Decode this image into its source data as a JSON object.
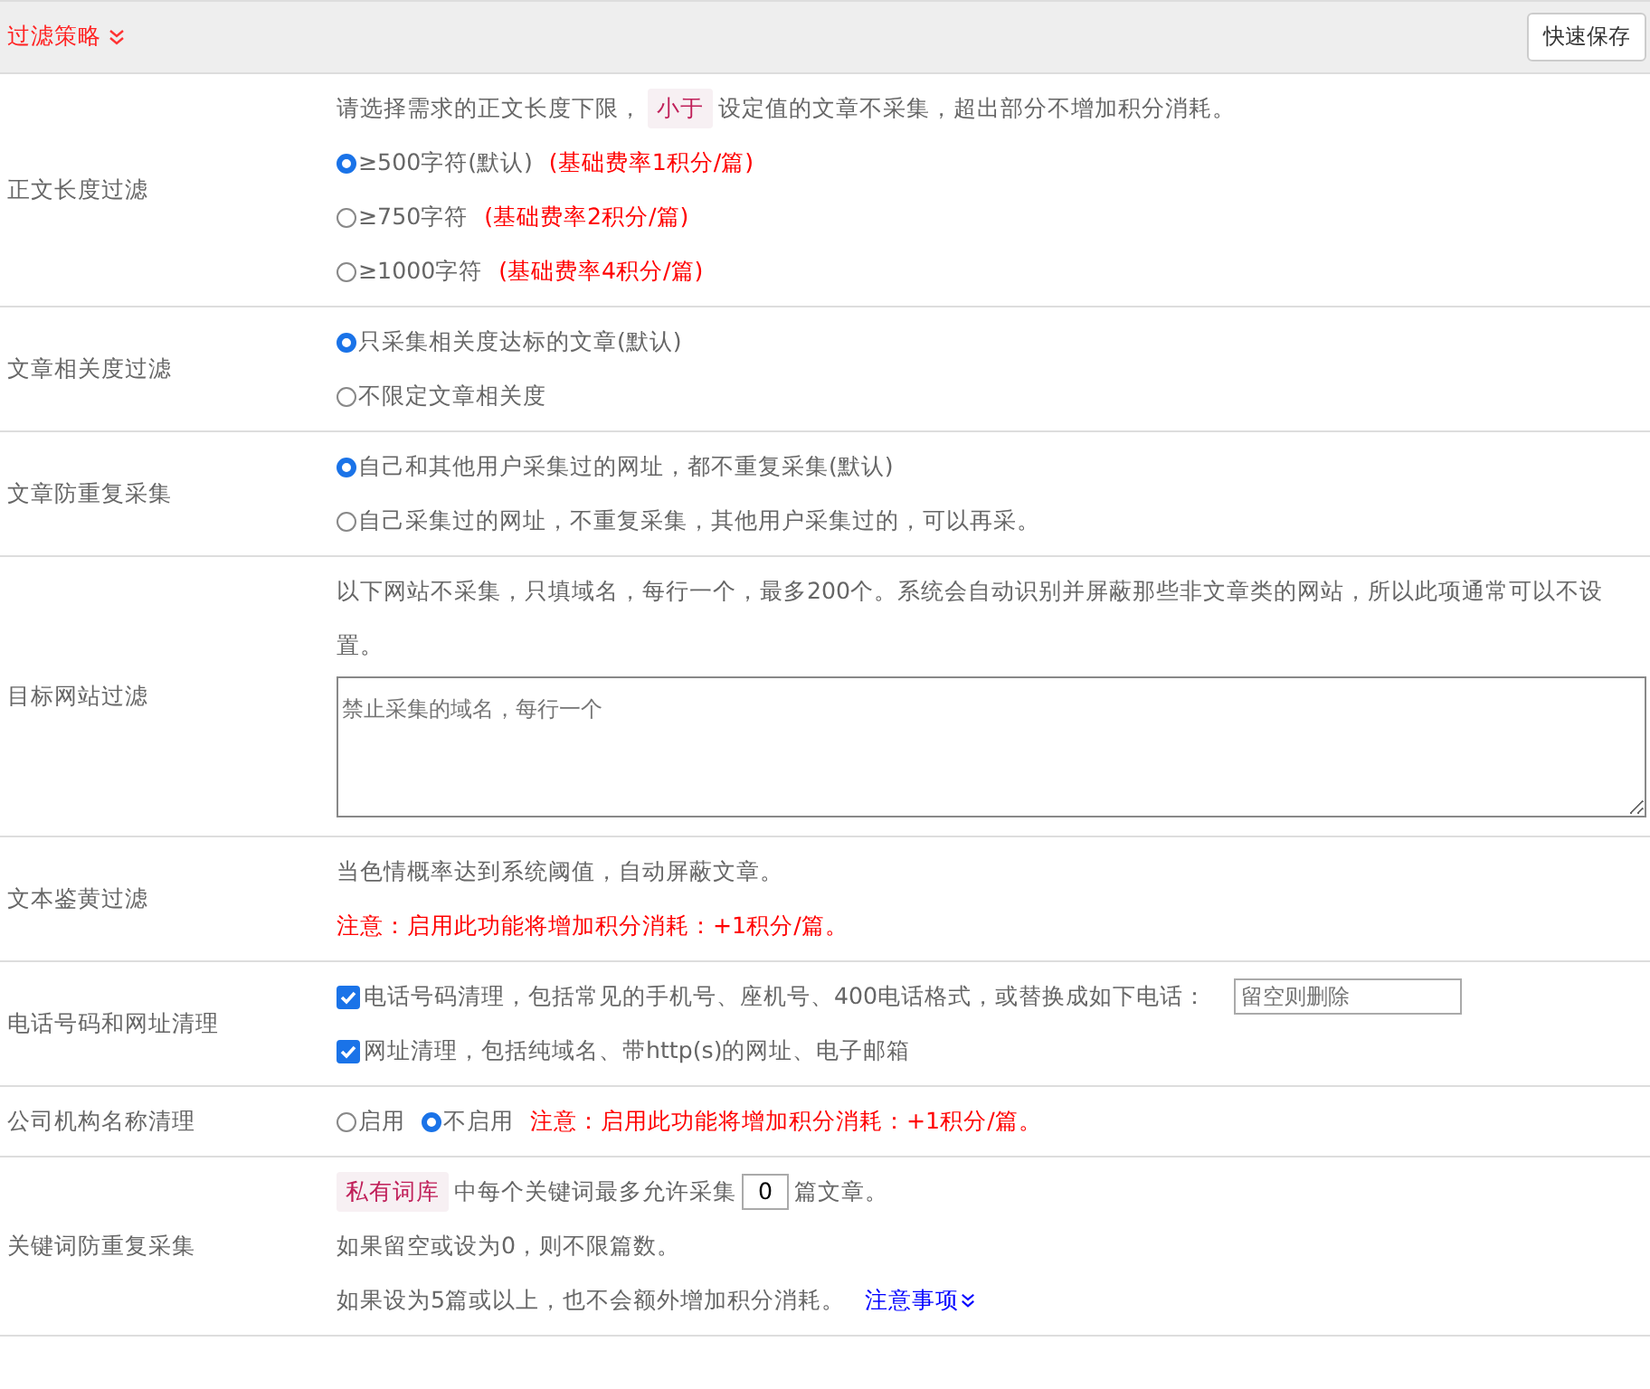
{
  "header": {
    "title": "过滤策略",
    "button": "快速保存"
  },
  "rows": [
    {
      "label": "正文长度过滤",
      "lines": [
        [
          {
            "kind": "text",
            "text": "请选择需求的正文长度下限，"
          },
          {
            "kind": "tag",
            "text": "小于"
          },
          {
            "kind": "text",
            "text": "设定值的文章不采集，超出部分不增加积分消耗。"
          }
        ],
        [
          {
            "kind": "radio",
            "text": "≥500字符(默认)",
            "selected": true
          },
          {
            "kind": "note",
            "text": "(基础费率1积分/篇)"
          }
        ],
        [
          {
            "kind": "radio",
            "text": "≥750字符",
            "selected": false
          },
          {
            "kind": "note",
            "text": "(基础费率2积分/篇)"
          }
        ],
        [
          {
            "kind": "radio",
            "text": "≥1000字符",
            "selected": false
          },
          {
            "kind": "note",
            "text": "(基础费率4积分/篇)"
          }
        ]
      ]
    },
    {
      "label": "文章相关度过滤",
      "lines": [
        [
          {
            "kind": "radio",
            "text": "只采集相关度达标的文章(默认)",
            "selected": true
          }
        ],
        [
          {
            "kind": "radio",
            "text": "不限定文章相关度",
            "selected": false
          }
        ]
      ]
    },
    {
      "label": "文章防重复采集",
      "lines": [
        [
          {
            "kind": "radio",
            "text": "自己和其他用户采集过的网址，都不重复采集(默认)",
            "selected": true
          }
        ],
        [
          {
            "kind": "radio",
            "text": "自己采集过的网址，不重复采集，其他用户采集过的，可以再采。",
            "selected": false
          }
        ]
      ]
    },
    {
      "label": "目标网站过滤",
      "lines": [
        [
          {
            "kind": "text",
            "text": "以下网站不采集，只填域名，每行一个，最多200个。系统会自动识别并屏蔽那些非文章类的网站，所以此项通常可以不设置。"
          }
        ],
        [
          {
            "kind": "textarea",
            "placeholder": "禁止采集的域名，每行一个"
          }
        ]
      ]
    },
    {
      "label": "文本鉴黄过滤",
      "lines": [
        [
          {
            "kind": "text",
            "text": "当色情概率达到系统阈值，自动屏蔽文章。"
          }
        ],
        [
          {
            "kind": "note",
            "text": "注意：启用此功能将增加积分消耗：+1积分/篇。"
          }
        ]
      ]
    },
    {
      "label": "电话号码和网址清理",
      "lines": [
        [
          {
            "kind": "checkbox",
            "text": "电话号码清理，包括常见的手机号、座机号、400电话格式，或替换成如下电话：",
            "checked": true
          },
          {
            "kind": "input",
            "placeholder": "留空则删除"
          }
        ],
        [
          {
            "kind": "checkbox",
            "text": "网址清理，包括纯域名、带http(s)的网址、电子邮箱",
            "checked": true
          }
        ]
      ]
    },
    {
      "label": "公司机构名称清理",
      "lines": [
        [
          {
            "kind": "radio",
            "text": "启用",
            "selected": false
          },
          {
            "kind": "radio",
            "text": "不启用",
            "selected": true
          },
          {
            "kind": "note",
            "text": "注意：启用此功能将增加积分消耗：+1积分/篇。"
          }
        ]
      ]
    },
    {
      "label": "关键词防重复采集",
      "lines": [
        [
          {
            "kind": "tag",
            "text": "私有词库"
          },
          {
            "kind": "text",
            "text": "中每个关键词最多允许采集"
          },
          {
            "kind": "number",
            "value": "0"
          },
          {
            "kind": "text",
            "text": "篇文章。"
          }
        ],
        [
          {
            "kind": "text",
            "text": "如果留空或设为0，则不限篇数。"
          }
        ],
        [
          {
            "kind": "text",
            "text": "如果设为5篇或以上，也不会额外增加积分消耗。"
          },
          {
            "kind": "link",
            "text": "注意事项"
          }
        ]
      ]
    }
  ]
}
